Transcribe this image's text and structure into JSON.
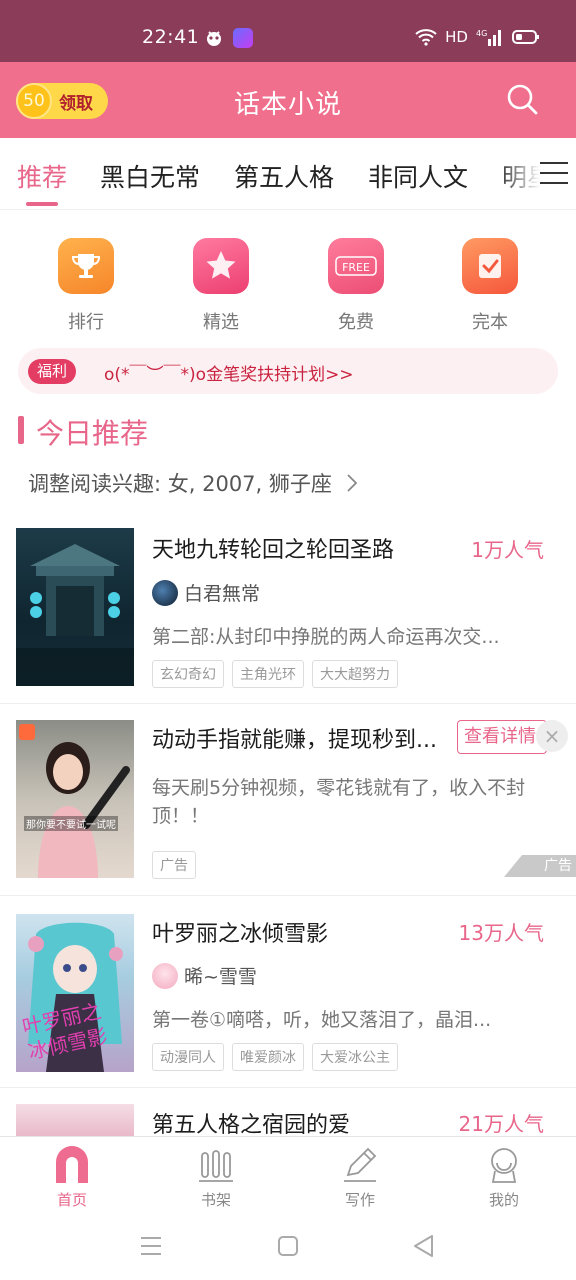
{
  "status_bar": {
    "time": "22:41",
    "network": "HD",
    "signal": "4G"
  },
  "header": {
    "coins": "50",
    "claim_label": "领取",
    "title": "话本小说"
  },
  "tabs": [
    "推荐",
    "黑白无常",
    "第五人格",
    "非同人文",
    "明星"
  ],
  "quick_links": [
    {
      "label": "排行",
      "icon": "trophy-icon",
      "color": "#f99a37"
    },
    {
      "label": "精选",
      "icon": "star-icon",
      "color": "#ee4f7d"
    },
    {
      "label": "免费",
      "icon": "free-icon",
      "color": "#ef5a7e",
      "badge": "FREE"
    },
    {
      "label": "完本",
      "icon": "check-book-icon",
      "color": "#f86a4f"
    }
  ],
  "welfare": {
    "tag": "福利",
    "text": "o(*￣︶￣*)o金笔奖扶持计划>>"
  },
  "section": {
    "title": "今日推荐",
    "interest": "调整阅读兴趣: 女, 2007, 狮子座"
  },
  "books": [
    {
      "title": "天地九转轮回之轮回圣路",
      "popularity": "1万人气",
      "author": "白君無常",
      "desc": "第二部:从封印中挣脱的两人命运再次交...",
      "tags": [
        "玄幻奇幻",
        "主角光环",
        "大大超努力"
      ]
    },
    {
      "title": "叶罗丽之冰倾雪影",
      "popularity": "13万人气",
      "author": "晞~雪雪",
      "desc": "第一卷①嘀嗒，听，她又落泪了，晶泪...",
      "tags": [
        "动漫同人",
        "唯爱颜冰",
        "大爱冰公主"
      ]
    },
    {
      "title": "第五人格之宿园的爱",
      "popularity": "21万人气"
    }
  ],
  "ad": {
    "title": "动动手指就能赚，提现秒到...",
    "button": "查看详情",
    "desc": "每天刷5分钟视频，零花钱就有了，收入不封顶！！",
    "tag": "广告",
    "mark": "广告",
    "cover_caption": "那你要不要试一试呢"
  },
  "bottom_nav": [
    {
      "label": "首页",
      "icon": "home-icon",
      "active": true
    },
    {
      "label": "书架",
      "icon": "bookshelf-icon",
      "active": false
    },
    {
      "label": "写作",
      "icon": "pen-icon",
      "active": false
    },
    {
      "label": "我的",
      "icon": "profile-icon",
      "active": false
    }
  ],
  "colors": {
    "accent": "#e8668a",
    "header": "#ef6f8c",
    "status_bar": "#8a3c58"
  }
}
